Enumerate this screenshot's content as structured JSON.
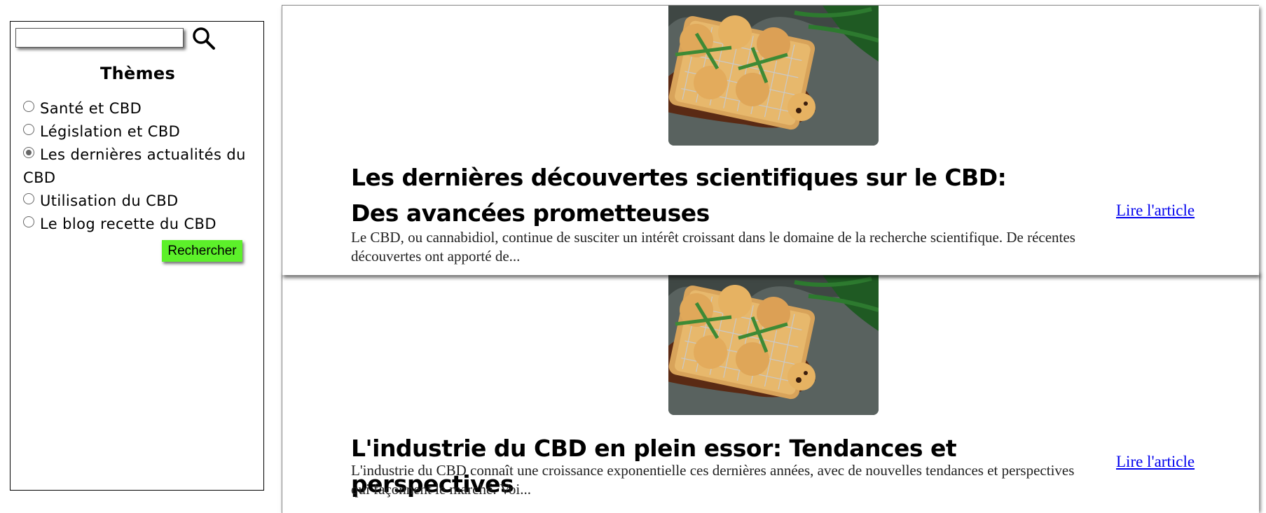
{
  "sidebar": {
    "search": {
      "value": "",
      "placeholder": ""
    },
    "themes_title": "Thèmes",
    "themes": [
      {
        "label": "Santé et CBD",
        "checked": false
      },
      {
        "label": "Législation et CBD",
        "checked": false
      },
      {
        "label": "Les dernières actualités du CBD",
        "checked": true
      },
      {
        "label": "Utilisation du CBD",
        "checked": false
      },
      {
        "label": "Le blog recette du CBD",
        "checked": false
      }
    ],
    "search_button": "Rechercher"
  },
  "articles": [
    {
      "title": "Les dernières découvertes scientifiques sur le CBD: Des avancées prometteuses",
      "excerpt": "Le CBD, ou cannabidiol, continue de susciter un intérêt croissant dans le domaine de la recherche scientifique. De récentes découvertes ont apporté de...",
      "link": "Lire l'article"
    },
    {
      "title": "L'industrie du CBD en plein essor: Tendances et perspectives",
      "excerpt": "L'industrie du CBD connaît une croissance exponentielle ces dernières années, avec de nouvelles tendances et perspectives qui façonnent le marché. Voi...",
      "link": "Lire l'article"
    }
  ],
  "colors": {
    "search_button_bg": "#5cf02a",
    "link": "#0000ee"
  }
}
